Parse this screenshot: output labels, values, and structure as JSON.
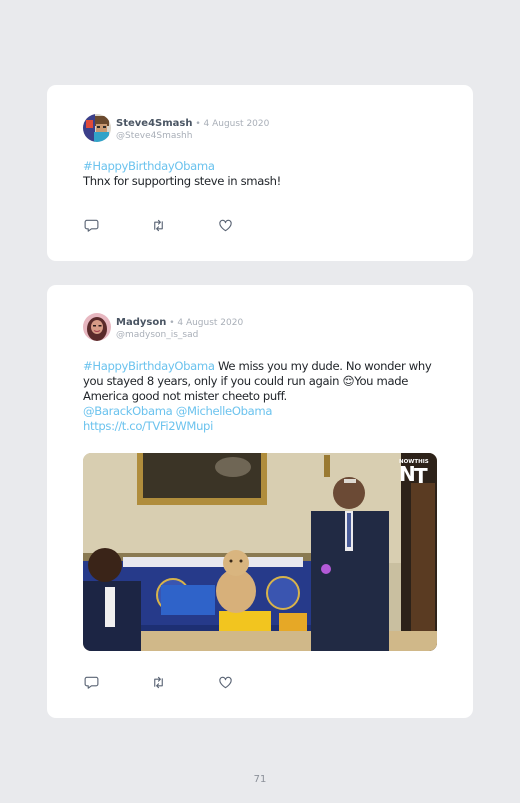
{
  "posts": [
    {
      "author": "Steve4Smash",
      "separator": " • ",
      "date": "4 August 2020",
      "handle": "@Steve4Smashh",
      "hashtag": "#HappyBirthdayObama",
      "text": "Thnx for supporting steve in smash!"
    },
    {
      "author": "Madyson",
      "separator": " • ",
      "date": "4 August 2020",
      "handle": "@madyson_is_sad",
      "hashtag": "#HappyBirthdayObama",
      "text_before_emoji": " We miss you my dude. No wonder why you stayed 8 years, only if you could run again ",
      "emoji": "😌",
      "text_after_emoji": "You made America good not mister cheeto puff.",
      "mentions": "@BarackObama @MichelleObama",
      "url": "https://t.co/TVFi2WMupi",
      "media_watermark": "NOWTHIS"
    }
  ],
  "icons": [
    "reply-icon",
    "retweet-icon",
    "like-icon"
  ],
  "colors": {
    "background": "#e9eaed",
    "card": "#ffffff",
    "link": "#6cc3ee",
    "muted": "#a9afb8"
  },
  "page_number": "71"
}
